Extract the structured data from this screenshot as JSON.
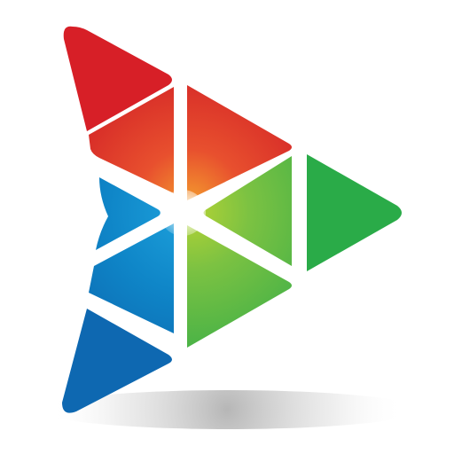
{
  "logo": {
    "icon": "play-triangle-mosaic-icon",
    "colors": {
      "red": "#d82027",
      "red_inner": "#e8502e",
      "orange_glow": "#f08a2c",
      "green": "#2fae4a",
      "green_light": "#8dc63f",
      "blue": "#0d6eb8",
      "blue_light": "#1994d2",
      "background": "#ffffff",
      "shadow": "#bdbdbd"
    }
  }
}
